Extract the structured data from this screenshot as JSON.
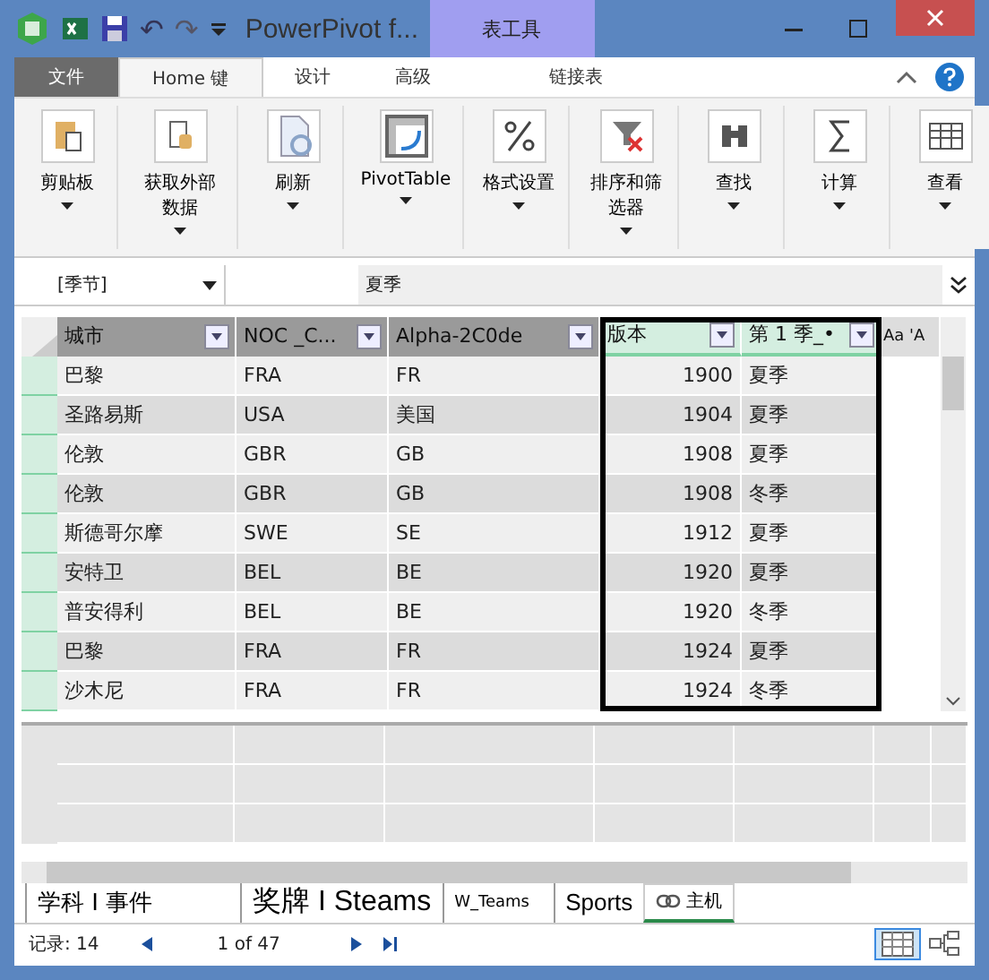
{
  "window": {
    "title": "PowerPivot f...",
    "context_tab": "表工具"
  },
  "quick_access": {
    "undo": "↶",
    "redo": "↷"
  },
  "tabs": [
    {
      "label": "文件",
      "kind": "file",
      "selected": false
    },
    {
      "label": "Home 键",
      "kind": "tab",
      "selected": true
    },
    {
      "label": "设计",
      "kind": "tab",
      "selected": false
    },
    {
      "label": "高级",
      "kind": "tab",
      "selected": false
    },
    {
      "label": "链接表",
      "kind": "context",
      "selected": false
    }
  ],
  "ribbon": [
    {
      "label": "剪贴板"
    },
    {
      "label": "获取外部数据"
    },
    {
      "label": "刷新"
    },
    {
      "label": "PivotTable"
    },
    {
      "label": "格式设置"
    },
    {
      "label": "排序和筛选器"
    },
    {
      "label": "查找"
    },
    {
      "label": "计算"
    },
    {
      "label": "查看"
    }
  ],
  "formula_bar": {
    "name_box": "[季节]",
    "value": "夏季"
  },
  "table": {
    "columns": [
      {
        "label": "城市",
        "selected": false
      },
      {
        "label": "NOC _C...",
        "selected": false
      },
      {
        "label": "Alpha-2C0de",
        "selected": false
      },
      {
        "label": "版本",
        "selected": true
      },
      {
        "label": "第 1 季_•",
        "selected": true
      },
      {
        "label": "Aa 'A",
        "selected": false
      }
    ],
    "rows": [
      [
        "巴黎",
        "FRA",
        "FR",
        "1900",
        "夏季"
      ],
      [
        "圣路易斯",
        "USA",
        "美国",
        "1904",
        "夏季"
      ],
      [
        "伦敦",
        "GBR",
        "GB",
        "1908",
        "夏季"
      ],
      [
        "伦敦",
        "GBR",
        "GB",
        "1908",
        "冬季"
      ],
      [
        "斯德哥尔摩",
        "SWE",
        "SE",
        "1912",
        "夏季"
      ],
      [
        "安特卫",
        "BEL",
        "BE",
        "1920",
        "夏季"
      ],
      [
        "普安得利",
        "BEL",
        "BE",
        "1920",
        "冬季"
      ],
      [
        "巴黎",
        "FRA",
        "FR",
        "1924",
        "夏季"
      ],
      [
        "沙木尼",
        "FRA",
        "FR",
        "1924",
        "冬季"
      ]
    ]
  },
  "sheet_tabs": [
    {
      "label": "学科 I 事件",
      "selected": false
    },
    {
      "label": "奖牌 I Steams",
      "selected": false
    },
    {
      "label": "W_Teams",
      "selected": false
    },
    {
      "label": "Sports",
      "selected": false
    },
    {
      "label": "主机",
      "selected": true
    }
  ],
  "status_bar": {
    "records": "记录: 14",
    "position": "1 of 47"
  }
}
